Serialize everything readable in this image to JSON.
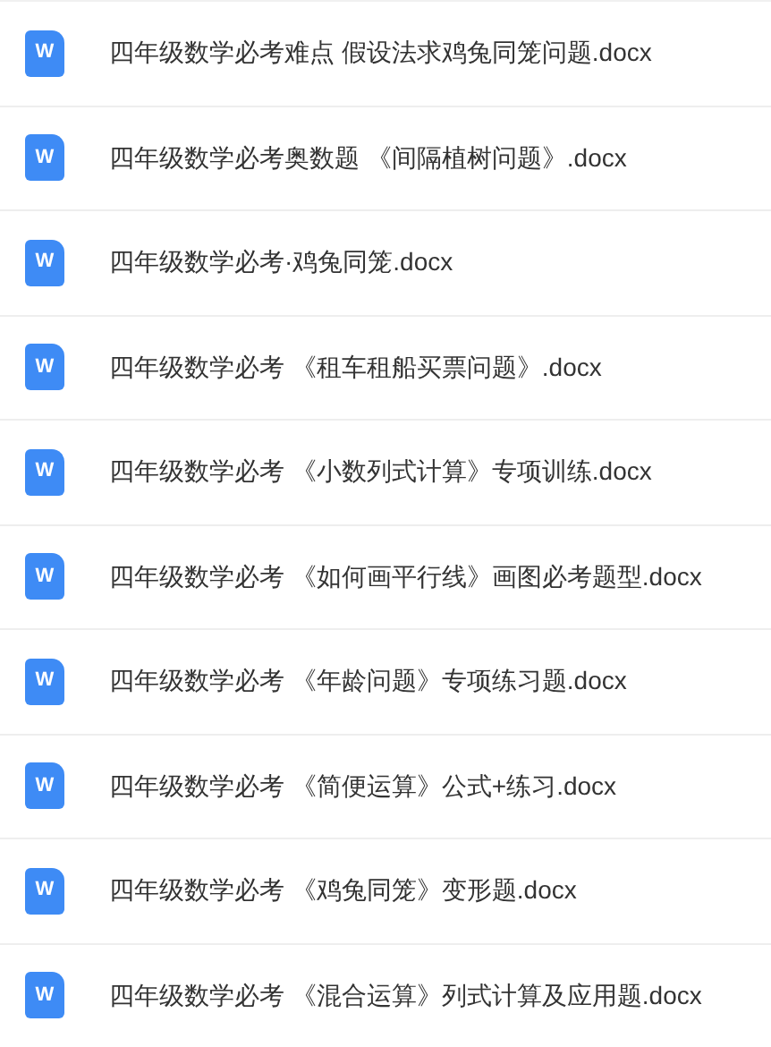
{
  "files": [
    {
      "icon_label": "W",
      "name": "四年级数学必考难点 假设法求鸡兔同笼问题.docx"
    },
    {
      "icon_label": "W",
      "name": "四年级数学必考奥数题 《间隔植树问题》.docx"
    },
    {
      "icon_label": "W",
      "name": "四年级数学必考·鸡兔同笼.docx"
    },
    {
      "icon_label": "W",
      "name": "四年级数学必考 《租车租船买票问题》.docx"
    },
    {
      "icon_label": "W",
      "name": "四年级数学必考 《小数列式计算》专项训练.docx"
    },
    {
      "icon_label": "W",
      "name": "四年级数学必考 《如何画平行线》画图必考题型.docx"
    },
    {
      "icon_label": "W",
      "name": "四年级数学必考 《年龄问题》专项练习题.docx"
    },
    {
      "icon_label": "W",
      "name": "四年级数学必考 《简便运算》公式+练习.docx"
    },
    {
      "icon_label": "W",
      "name": "四年级数学必考 《鸡兔同笼》变形题.docx"
    },
    {
      "icon_label": "W",
      "name": "四年级数学必考 《混合运算》列式计算及应用题.docx"
    }
  ]
}
